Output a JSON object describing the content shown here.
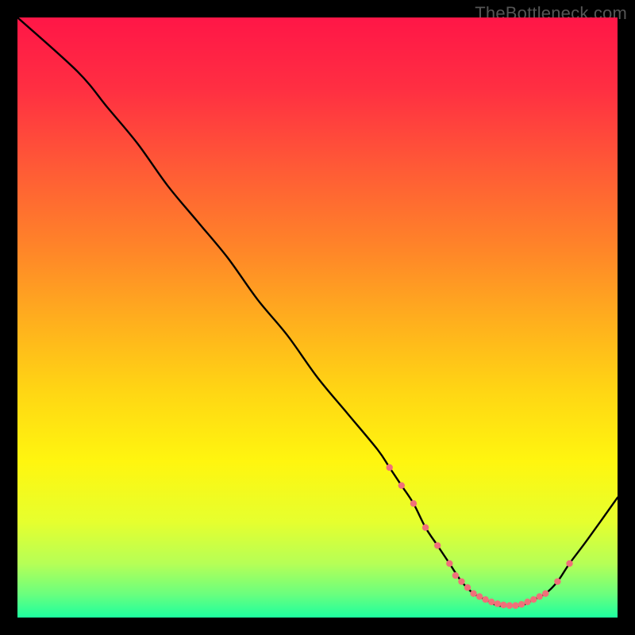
{
  "attribution": "TheBottleneck.com",
  "chart_data": {
    "type": "line",
    "title": "",
    "xlabel": "",
    "ylabel": "",
    "xlim": [
      0,
      100
    ],
    "ylim": [
      0,
      100
    ],
    "series": [
      {
        "name": "bottleneck-curve",
        "x": [
          0,
          10,
          15,
          20,
          25,
          30,
          35,
          40,
          45,
          50,
          55,
          60,
          62,
          64,
          66,
          68,
          70,
          72,
          74,
          76,
          78,
          80,
          82,
          84,
          86,
          88,
          90,
          92,
          95,
          100
        ],
        "y": [
          100,
          91,
          85,
          79,
          72,
          66,
          60,
          53,
          47,
          40,
          34,
          28,
          25,
          22,
          19,
          15,
          12,
          9,
          6,
          4,
          3,
          2,
          2,
          2,
          3,
          4,
          6,
          9,
          13,
          20
        ]
      }
    ],
    "markers": {
      "name": "sample-points",
      "color": "#f07079",
      "radius": 4.2,
      "x": [
        62,
        64,
        66,
        68,
        70,
        72,
        73,
        74,
        75,
        76,
        77,
        78,
        79,
        80,
        81,
        82,
        83,
        84,
        85,
        86,
        87,
        88,
        90,
        92
      ],
      "y": [
        25,
        22,
        19,
        15,
        12,
        9,
        7,
        6,
        5,
        4,
        3.5,
        3,
        2.6,
        2.3,
        2.1,
        2,
        2,
        2.2,
        2.6,
        3,
        3.5,
        4,
        6,
        9
      ]
    },
    "background_gradient": [
      {
        "offset": 0.0,
        "color": "#ff1647"
      },
      {
        "offset": 0.12,
        "color": "#ff2f42"
      },
      {
        "offset": 0.25,
        "color": "#ff5a36"
      },
      {
        "offset": 0.38,
        "color": "#ff8329"
      },
      {
        "offset": 0.5,
        "color": "#ffad1e"
      },
      {
        "offset": 0.62,
        "color": "#ffd514"
      },
      {
        "offset": 0.74,
        "color": "#fff60f"
      },
      {
        "offset": 0.84,
        "color": "#e6ff2e"
      },
      {
        "offset": 0.91,
        "color": "#b6ff56"
      },
      {
        "offset": 0.96,
        "color": "#6cff7d"
      },
      {
        "offset": 1.0,
        "color": "#1dff9f"
      }
    ]
  }
}
